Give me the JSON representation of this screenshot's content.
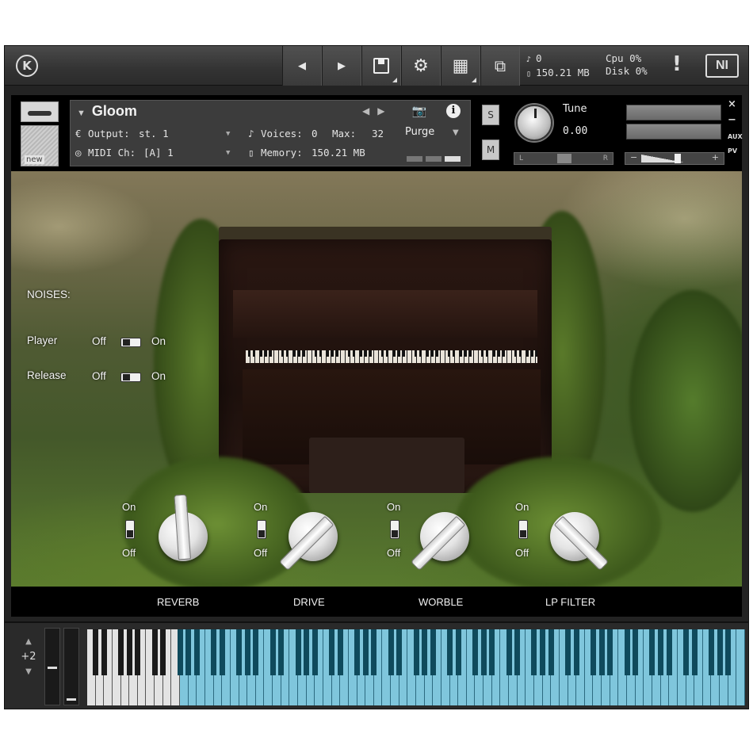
{
  "toolbar": {
    "logo": "K",
    "prev_glyph": "◀",
    "next_glyph": "▶",
    "save_glyph": "💾",
    "gear_glyph": "⚙",
    "layout_glyph": "▦",
    "view_glyph": "⧉",
    "voices": "0",
    "memory": "150.21 MB",
    "cpu_label": "Cpu",
    "cpu_value": "0%",
    "disk_label": "Disk",
    "disk_value": "0%",
    "warning": "!",
    "brand": "NI"
  },
  "instrument": {
    "wrench_glyph": "🔧",
    "thumb_label": "new",
    "name": "Gloom",
    "dropdown_glyph": "▼",
    "output_label": "Output:",
    "output_value": "st. 1",
    "voices_label": "Voices:",
    "voices_value": "0",
    "max_label": "Max:",
    "max_value": "32",
    "midi_label": "MIDI Ch:",
    "midi_value": "[A]  1",
    "memory_label": "Memory:",
    "memory_value": "150.21 MB",
    "purge_label": "Purge",
    "solo": "S",
    "mute": "M",
    "tune_label": "Tune",
    "tune_value": "0.00",
    "pan_left": "L",
    "pan_right": "R",
    "vol_minus": "−",
    "vol_plus": "+",
    "close": "×",
    "minimize": "−",
    "aux": "AUX",
    "pv": "PV",
    "camera_glyph": "📷",
    "info_glyph": "i"
  },
  "noises": {
    "title": "NOISES:",
    "rows": [
      {
        "label": "Player",
        "off": "Off",
        "on": "On"
      },
      {
        "label": "Release",
        "off": "Off",
        "on": "On"
      }
    ]
  },
  "effects": [
    {
      "label": "REVERB",
      "on": "On",
      "off": "Off",
      "enabled": false
    },
    {
      "label": "DRIVE",
      "on": "On",
      "off": "Off",
      "enabled": false
    },
    {
      "label": "WORBLE",
      "on": "On",
      "off": "Off",
      "enabled": false
    },
    {
      "label": "LP FILTER",
      "on": "On",
      "off": "Off",
      "enabled": false
    }
  ],
  "keyboard": {
    "octave_up": "▲",
    "octave_value": "+2",
    "octave_down": "▼",
    "mapped_color": "#7fc6dc",
    "unmapped_color": "#e3e3e3"
  }
}
